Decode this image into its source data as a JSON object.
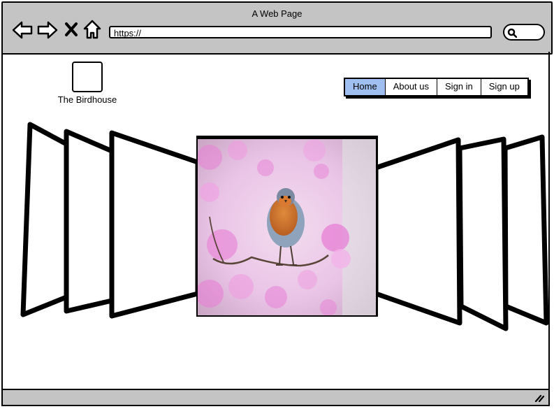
{
  "window": {
    "title": "A Web Page"
  },
  "toolbar": {
    "icons": [
      "back-arrow-icon",
      "forward-arrow-icon",
      "close-x-icon",
      "home-icon",
      "search-icon"
    ],
    "url_value": "https://"
  },
  "site": {
    "logo_label": "The Birdhouse",
    "menu": [
      {
        "label": "Home",
        "active": true
      },
      {
        "label": "About us",
        "active": false
      },
      {
        "label": "Sign in",
        "active": false
      },
      {
        "label": "Sign up",
        "active": false
      }
    ]
  },
  "carousel": {
    "center_image": "robin-on-branch-photo",
    "left_placeholder_count": 3,
    "right_placeholder_count": 3
  },
  "colors": {
    "chrome": "#c4c4c4",
    "menu_active": "#9ebfef",
    "photo_bg": "#e9c3e6",
    "blossom": "#e77fd5"
  }
}
